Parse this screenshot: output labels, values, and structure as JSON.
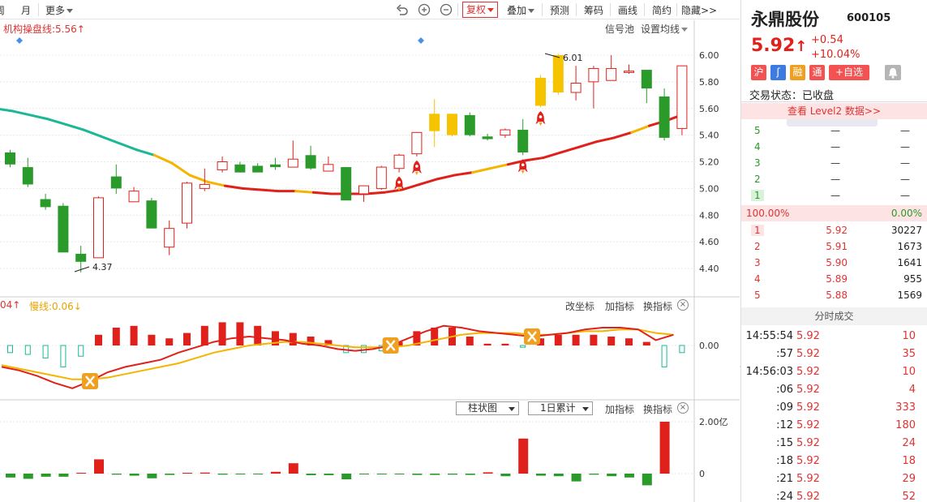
{
  "toolbar": {
    "left_items": [
      "周",
      "月"
    ],
    "more_label": "更多",
    "fuquan_label": "复权",
    "diejia_label": "叠加",
    "yuce_label": "预测",
    "chouma_label": "筹码",
    "huaxian_label": "画线",
    "jianji_label": "简约",
    "yincang_label": "隐藏>>"
  },
  "main_chart": {
    "indicator_label": "机构操盘线:5.56↑",
    "signal_pool_label": "信号池",
    "set_ma_label": "设置均线",
    "y_ticks": [
      "6.00",
      "5.80",
      "5.60",
      "5.40",
      "5.20",
      "5.00",
      "4.80",
      "4.60",
      "4.40"
    ],
    "high_label": "6.01",
    "low_label": "4.37",
    "colors": {
      "up": "#e0211b",
      "down": "#2a9a2a",
      "signal": "#f5c300",
      "ma_green": "#1ab894",
      "ma_yellow": "#f5b400",
      "ma_red": "#e0211b"
    }
  },
  "chart_data": {
    "type": "candlestick",
    "ylim": [
      4.3,
      6.1
    ],
    "candles": [
      {
        "o": 5.27,
        "h": 5.29,
        "c": 5.18,
        "l": 5.16
      },
      {
        "o": 5.16,
        "h": 5.23,
        "c": 5.03,
        "l": 5.01
      },
      {
        "o": 4.92,
        "h": 4.96,
        "c": 4.86,
        "l": 4.84
      },
      {
        "o": 4.87,
        "h": 4.89,
        "c": 4.52,
        "l": 4.52
      },
      {
        "o": 4.51,
        "h": 4.57,
        "c": 4.45,
        "l": 4.37
      },
      {
        "o": 4.48,
        "h": 4.94,
        "c": 4.93,
        "l": 4.48
      },
      {
        "o": 5.09,
        "h": 5.18,
        "c": 5.0,
        "l": 4.96
      },
      {
        "o": 4.9,
        "h": 5.01,
        "c": 4.98,
        "l": 4.9
      },
      {
        "o": 4.91,
        "h": 4.93,
        "c": 4.7,
        "l": 4.7
      },
      {
        "o": 4.56,
        "h": 4.76,
        "c": 4.7,
        "l": 4.5
      },
      {
        "o": 4.74,
        "h": 5.05,
        "c": 5.04,
        "l": 4.7
      },
      {
        "o": 5.0,
        "h": 5.15,
        "c": 5.03,
        "l": 4.98
      },
      {
        "o": 5.14,
        "h": 5.24,
        "c": 5.2,
        "l": 5.12
      },
      {
        "o": 5.18,
        "h": 5.2,
        "c": 5.12,
        "l": 5.12
      },
      {
        "o": 5.17,
        "h": 5.19,
        "c": 5.12,
        "l": 5.12
      },
      {
        "o": 5.18,
        "h": 5.23,
        "c": 5.16,
        "l": 5.14
      },
      {
        "o": 5.16,
        "h": 5.36,
        "c": 5.22,
        "l": 5.16
      },
      {
        "o": 5.25,
        "h": 5.32,
        "c": 5.15,
        "l": 5.14
      },
      {
        "o": 5.13,
        "h": 5.24,
        "c": 5.18,
        "l": 5.13
      },
      {
        "o": 5.16,
        "h": 5.16,
        "c": 4.91,
        "l": 4.91
      },
      {
        "o": 4.96,
        "h": 5.02,
        "c": 5.02,
        "l": 4.9
      },
      {
        "o": 5.0,
        "h": 5.17,
        "c": 5.16,
        "l": 4.99
      },
      {
        "o": 5.15,
        "h": 5.26,
        "c": 5.25,
        "l": 5.12
      },
      {
        "o": 5.26,
        "h": 5.42,
        "c": 5.42,
        "l": 5.24
      },
      {
        "o": 5.43,
        "h": 5.67,
        "c": 5.56,
        "l": 5.31
      },
      {
        "o": 5.4,
        "h": 5.56,
        "c": 5.56,
        "l": 5.39
      },
      {
        "o": 5.55,
        "h": 5.57,
        "c": 5.4,
        "l": 5.39
      },
      {
        "o": 5.39,
        "h": 5.41,
        "c": 5.37,
        "l": 5.36
      },
      {
        "o": 5.4,
        "h": 5.45,
        "c": 5.44,
        "l": 5.38
      },
      {
        "o": 5.44,
        "h": 5.52,
        "c": 5.27,
        "l": 5.25
      },
      {
        "o": 5.62,
        "h": 5.85,
        "c": 5.83,
        "l": 5.61
      },
      {
        "o": 5.72,
        "h": 6.01,
        "c": 6.0,
        "l": 5.7
      },
      {
        "o": 5.72,
        "h": 5.92,
        "c": 5.79,
        "l": 5.66
      },
      {
        "o": 5.8,
        "h": 5.92,
        "c": 5.9,
        "l": 5.6
      },
      {
        "o": 5.81,
        "h": 6.0,
        "c": 5.9,
        "l": 5.81
      },
      {
        "o": 5.87,
        "h": 5.93,
        "c": 5.88,
        "l": 5.86
      },
      {
        "o": 5.89,
        "h": 5.89,
        "c": 5.75,
        "l": 5.64
      },
      {
        "o": 5.69,
        "h": 5.75,
        "c": 5.38,
        "l": 5.36
      },
      {
        "o": 5.45,
        "h": 5.92,
        "c": 5.92,
        "l": 5.4
      }
    ],
    "signal_candles": [
      24,
      25,
      30,
      31
    ],
    "ma_line": [
      5.6,
      5.58,
      5.55,
      5.52,
      5.48,
      5.44,
      5.39,
      5.34,
      5.29,
      5.25,
      5.19,
      5.1,
      5.05,
      5.02,
      5.0,
      4.99,
      4.98,
      4.98,
      4.97,
      4.96,
      4.96,
      4.96,
      4.97,
      4.99,
      5.03,
      5.07,
      5.1,
      5.12,
      5.15,
      5.18,
      5.21,
      5.23,
      5.27,
      5.31,
      5.35,
      5.38,
      5.42,
      5.47,
      5.51,
      5.56
    ]
  },
  "macd_panel": {
    "left_label": "04↑",
    "slow_label": "慢线:0.06↓",
    "change_axis_label": "改坐标",
    "add_indicator_label": "加指标",
    "switch_indicator_label": "换指标",
    "zero_tick": "0.00",
    "bars": [
      -0.4,
      -0.5,
      -0.7,
      -1.2,
      -0.6,
      0.6,
      1.0,
      1.1,
      0.6,
      0.4,
      0.7,
      1.1,
      1.3,
      1.3,
      1.1,
      0.8,
      0.7,
      0.5,
      0.3,
      -0.4,
      -0.4,
      -0.3,
      0.2,
      0.8,
      1.0,
      1.0,
      0.5,
      0.1,
      0.1,
      -0.1,
      0.4,
      0.6,
      0.6,
      0.6,
      0.5,
      0.4,
      0.2,
      -1.2,
      -0.4
    ],
    "fast": [
      -1.2,
      -1.4,
      -1.7,
      -2.1,
      -2.4,
      -2.0,
      -1.5,
      -1.2,
      -1.0,
      -0.8,
      -0.4,
      -0.1,
      0.2,
      0.4,
      0.5,
      0.4,
      0.3,
      0.1,
      0.0,
      -0.2,
      -0.3,
      -0.2,
      0.0,
      0.4,
      0.8,
      1.1,
      1.0,
      0.8,
      0.7,
      0.6,
      0.5,
      0.6,
      0.7,
      0.9,
      1.0,
      1.0,
      0.9,
      0.3,
      0.6
    ],
    "slow": [
      -1.1,
      -1.3,
      -1.5,
      -1.7,
      -1.9,
      -1.9,
      -1.8,
      -1.6,
      -1.4,
      -1.2,
      -1.0,
      -0.7,
      -0.4,
      -0.2,
      0.0,
      0.1,
      0.2,
      0.2,
      0.1,
      0.0,
      -0.1,
      -0.1,
      -0.1,
      0.0,
      0.2,
      0.4,
      0.6,
      0.7,
      0.7,
      0.7,
      0.6,
      0.6,
      0.7,
      0.8,
      0.8,
      0.9,
      0.9,
      0.7,
      0.6
    ],
    "x_marks": [
      5,
      22,
      30
    ]
  },
  "volume_panel": {
    "chart_type_label": "柱状图",
    "accum_label": "1日累计",
    "add_indicator_label": "加指标",
    "switch_indicator_label": "换指标",
    "y_ticks": [
      "2.00亿",
      "0"
    ],
    "values": [
      -0.15,
      -0.2,
      -0.12,
      -0.12,
      0.03,
      0.55,
      -0.04,
      -0.08,
      -0.18,
      -0.05,
      0.03,
      0.04,
      -0.04,
      -0.03,
      -0.03,
      0.07,
      0.4,
      -0.06,
      -0.06,
      -0.22,
      -0.02,
      -0.02,
      -0.03,
      -0.05,
      -0.05,
      -0.04,
      -0.05,
      0.05,
      -0.1,
      1.35,
      -0.08,
      -0.1,
      -0.3,
      -0.04,
      -0.1,
      -0.15,
      -0.45,
      2.0
    ]
  },
  "right_panel": {
    "stock_name": "永鼎股份",
    "stock_code": "600105",
    "price": "5.92",
    "price_arrow": "↑",
    "change_abs": "+0.54",
    "change_pct": "+10.04%",
    "tags": [
      "沪",
      "ʃ",
      "融",
      "通"
    ],
    "add_watch_label": "+自选",
    "status_label": "交易状态：已收盘",
    "level2_label": "查看 Level2 数据>>",
    "asks": [
      {
        "level": "5",
        "price": "—",
        "vol": "—"
      },
      {
        "level": "4",
        "price": "—",
        "vol": "—"
      },
      {
        "level": "3",
        "price": "—",
        "vol": "—"
      },
      {
        "level": "2",
        "price": "—",
        "vol": "—"
      },
      {
        "level": "1",
        "price": "—",
        "vol": "—"
      }
    ],
    "ratio_left": "100.00%",
    "ratio_right": "0.00%",
    "bids": [
      {
        "level": "1",
        "price": "5.92",
        "vol": "30227"
      },
      {
        "level": "2",
        "price": "5.91",
        "vol": "1673"
      },
      {
        "level": "3",
        "price": "5.90",
        "vol": "1641"
      },
      {
        "level": "4",
        "price": "5.89",
        "vol": "955"
      },
      {
        "level": "5",
        "price": "5.88",
        "vol": "1569"
      }
    ],
    "ticks_title": "分时成交",
    "ticks": [
      {
        "time": "14:55:54",
        "price": "5.92",
        "vol": "10"
      },
      {
        "time": ":57",
        "price": "5.92",
        "vol": "35"
      },
      {
        "time": "14:56:03",
        "price": "5.92",
        "vol": "10"
      },
      {
        "time": ":06",
        "price": "5.92",
        "vol": "4"
      },
      {
        "time": ":09",
        "price": "5.92",
        "vol": "333"
      },
      {
        "time": ":12",
        "price": "5.92",
        "vol": "180"
      },
      {
        "time": ":15",
        "price": "5.92",
        "vol": "24"
      },
      {
        "time": ":18",
        "price": "5.92",
        "vol": "18"
      },
      {
        "time": ":21",
        "price": "5.92",
        "vol": "29"
      },
      {
        "time": ":24",
        "price": "5.92",
        "vol": "52"
      }
    ]
  }
}
